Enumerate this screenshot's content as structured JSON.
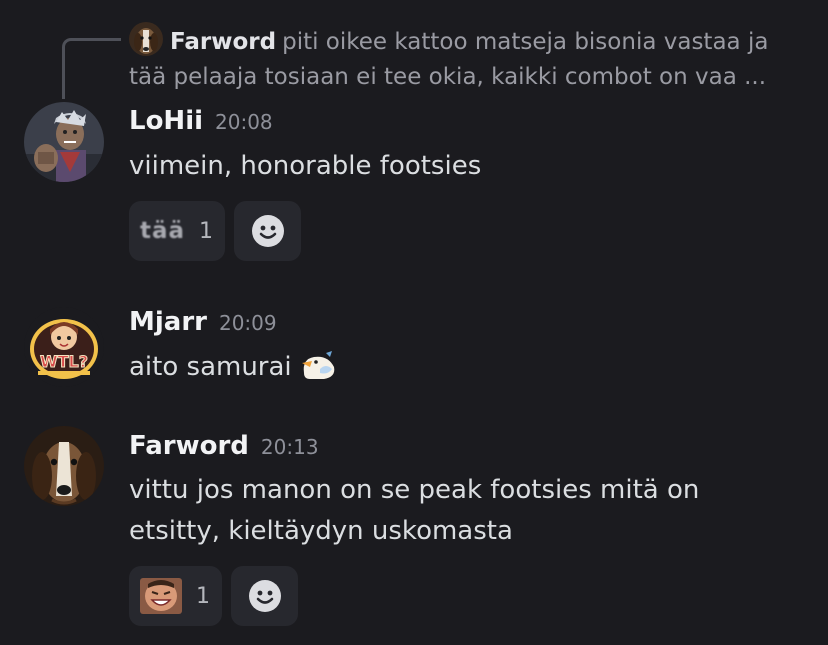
{
  "reply": {
    "author": "Farword",
    "text": "piti oikee kattoo matseja bisonia vastaa ja tää pelaaja tosiaan ei tee okia, kaikki combot on vaa ..."
  },
  "messages": [
    {
      "author": "LoHii",
      "time": "20:08",
      "text": "viimein, honorable footsies",
      "reactions": [
        {
          "emoji": "tää",
          "count": "1"
        }
      ]
    },
    {
      "author": "Mjarr",
      "time": "20:09",
      "text": "aito samurai"
    },
    {
      "author": "Farword",
      "time": "20:13",
      "text": "vittu jos manon on se peak footsies mitä on etsitty, kieltäydyn uskomasta",
      "reactions": [
        {
          "emoji": "laughing-face-emoji",
          "count": "1"
        }
      ]
    }
  ],
  "icons": {
    "add_reaction": "smiley-add-reaction-icon",
    "duck": "duck-sticker-emoji"
  },
  "colors": {
    "background": "#1b1b1f",
    "author": "#f2f3f5",
    "message_text": "#dbdee1",
    "timestamp": "#8e9099",
    "reaction_bg": "#27282e"
  }
}
